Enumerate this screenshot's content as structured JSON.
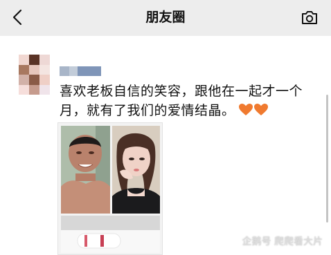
{
  "nav": {
    "title": "朋友圈",
    "back_icon": "chevron-left-icon",
    "camera_icon": "camera-icon"
  },
  "post": {
    "text": "喜欢老板自信的笑容，跟他在一起才一个月，就有了我们的爱情结晶。",
    "emoji": "heart-icon x2"
  },
  "watermark": {
    "text": "企鹅号 爬爬看大片"
  },
  "colors": {
    "topbar": "#ededed",
    "heart": "#f07a2f",
    "username_blur": "#7f95b8"
  }
}
